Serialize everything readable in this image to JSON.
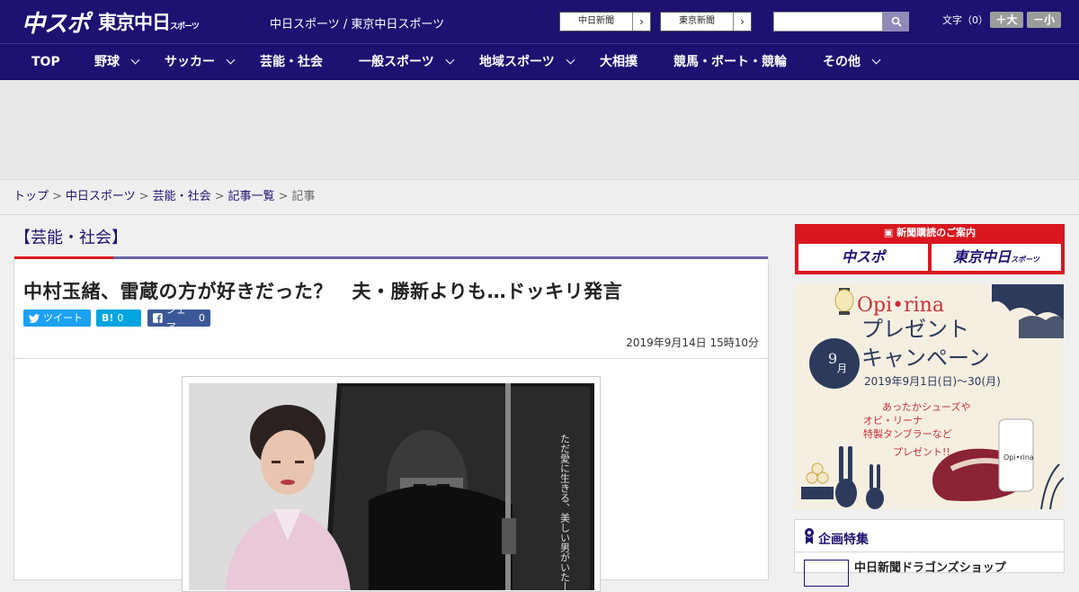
{
  "header": {
    "logo_primary": "中スポ",
    "logo_secondary": "東京中日",
    "logo_secondary_small": "スポーツ",
    "site_title": "中日スポーツ / 東京中日スポーツ",
    "ext_links": [
      "中日新聞",
      "東京新聞"
    ],
    "search_placeholder": "",
    "font_size_label": "文字（0）",
    "font_bigger": "＋大",
    "font_smaller": "－小"
  },
  "nav": {
    "items": [
      {
        "label": "TOP",
        "dropdown": false
      },
      {
        "label": "野球",
        "dropdown": true
      },
      {
        "label": "サッカー",
        "dropdown": true
      },
      {
        "label": "芸能・社会",
        "dropdown": false
      },
      {
        "label": "一般スポーツ",
        "dropdown": true
      },
      {
        "label": "地域スポーツ",
        "dropdown": true
      },
      {
        "label": "大相撲",
        "dropdown": false
      },
      {
        "label": "競馬・ボート・競輪",
        "dropdown": false
      },
      {
        "label": "その他",
        "dropdown": true
      }
    ]
  },
  "breadcrumb": {
    "items": [
      "トップ",
      "中日スポーツ",
      "芸能・社会",
      "記事一覧"
    ],
    "current": "記事",
    "separator": ">"
  },
  "article": {
    "category": "【芸能・社会】",
    "headline": "中村玉緒、雷蔵の方が好きだった？　夫・勝新よりも…ドッキリ発言",
    "share": {
      "tweet": "ツイート",
      "hatena_label": "B!",
      "hatena_count": "0",
      "facebook": "シェア",
      "facebook_count": "0"
    },
    "date": "2019年9月14日 15時10分",
    "photo_caption_text": "ただ愛に生きる、美しい男がいた──"
  },
  "sidebar": {
    "subscription_title": "新聞購読のご案内",
    "subscription_logos": [
      "中スポ",
      "東京中日"
    ],
    "subscription_logo_small": "スポーツ",
    "promo": {
      "brand": "Opi•rina",
      "title_line1": "プレゼント",
      "title_line2": "キャンペーン",
      "month_number": "9",
      "month_unit": "月",
      "period": "2019年9月1日(日)〜30(月)",
      "text_line1": "あったかシューズや",
      "text_line2": "オビ・リーナ",
      "text_line3": "特製タンブラーなど",
      "text_line4": "プレゼント!!"
    },
    "feature_title": "企画特集",
    "feature_item": "中日新聞ドラゴンズショップ"
  },
  "colors": {
    "header_bg": "#1d1271",
    "accent_red": "#d9171f",
    "tweet_blue": "#1da1f2",
    "hatena_blue": "#00a4de",
    "facebook_blue": "#3b5998"
  }
}
